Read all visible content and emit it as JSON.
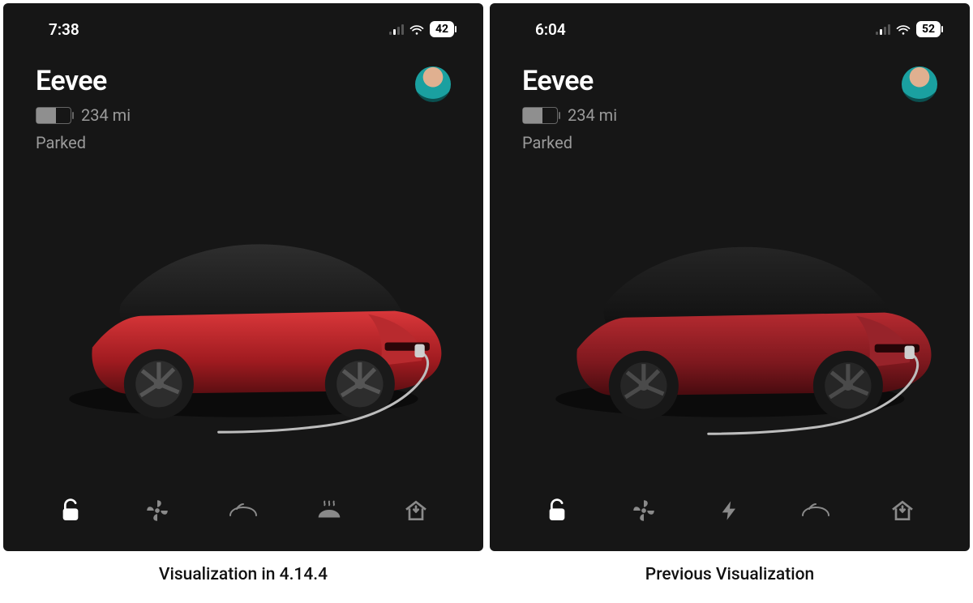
{
  "panels": [
    {
      "status": {
        "time": "7:38",
        "battery_pct": "42"
      },
      "header": {
        "vehicle_name": "Eevee",
        "range": "234 mi",
        "status": "Parked",
        "battery_fill_pct": 58
      },
      "quick_actions": [
        {
          "name": "lock",
          "icon": "unlock-icon",
          "active": true
        },
        {
          "name": "fan",
          "icon": "fan-icon",
          "active": false
        },
        {
          "name": "frunk",
          "icon": "frunk-icon",
          "active": false
        },
        {
          "name": "defrost",
          "icon": "defrost-icon",
          "active": false
        },
        {
          "name": "home",
          "icon": "homelink-icon",
          "active": false
        }
      ],
      "caption": "Visualization in 4.14.4"
    },
    {
      "status": {
        "time": "6:04",
        "battery_pct": "52"
      },
      "header": {
        "vehicle_name": "Eevee",
        "range": "234 mi",
        "status": "Parked",
        "battery_fill_pct": 58
      },
      "quick_actions": [
        {
          "name": "lock",
          "icon": "unlock-icon",
          "active": true
        },
        {
          "name": "fan",
          "icon": "fan-icon",
          "active": false
        },
        {
          "name": "charge",
          "icon": "bolt-icon",
          "active": false
        },
        {
          "name": "frunk",
          "icon": "frunk-icon",
          "active": false
        },
        {
          "name": "home",
          "icon": "homelink-icon",
          "active": false
        }
      ],
      "caption": "Previous Visualization"
    }
  ]
}
